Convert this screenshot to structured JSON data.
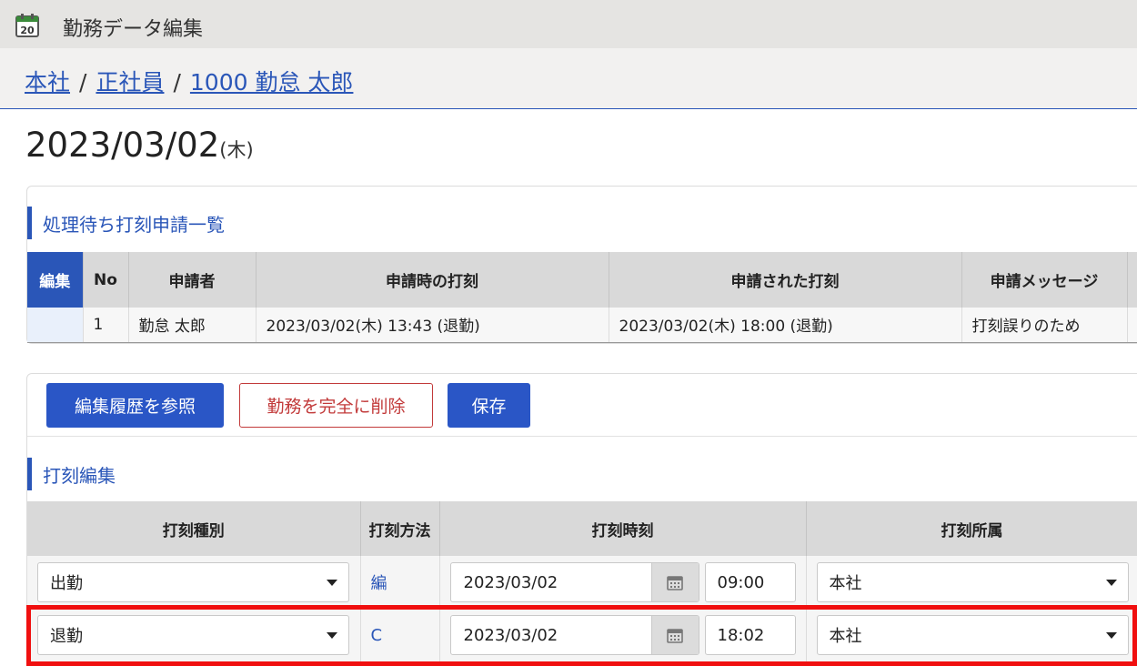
{
  "window": {
    "title": "勤務データ編集",
    "icon": "calendar-icon",
    "icon_number": "20"
  },
  "breadcrumb": {
    "items": [
      "本社",
      "正社員",
      "1000 勤怠 太郎"
    ],
    "separator": "/"
  },
  "page": {
    "date": "2023/03/02",
    "weekday": "(木)"
  },
  "pending_requests": {
    "title": "処理待ち打刻申請一覧",
    "headers": {
      "edit": "編集",
      "no": "No",
      "applicant": "申請者",
      "original": "申請時の打刻",
      "requested": "申請された打刻",
      "message": "申請メッセージ"
    },
    "rows": [
      {
        "no": "1",
        "applicant": "勤怠 太郎",
        "original": "2023/03/02(木) 13:43 (退勤)",
        "requested": "2023/03/02(木) 18:00 (退勤)",
        "message": "打刻誤りのため"
      }
    ]
  },
  "actions": {
    "history": "編集履歴を参照",
    "delete": "勤務を完全に削除",
    "save": "保存"
  },
  "punch_edit": {
    "title": "打刻編集",
    "headers": {
      "type": "打刻種別",
      "method": "打刻方法",
      "time": "打刻時刻",
      "affiliation": "打刻所属"
    },
    "rows": [
      {
        "type": "出勤",
        "method": "編",
        "date": "2023/03/02",
        "time": "09:00",
        "affiliation": "本社"
      },
      {
        "type": "退勤",
        "method": "C",
        "date": "2023/03/02",
        "time": "18:02",
        "affiliation": "本社"
      }
    ]
  },
  "colors": {
    "accent": "#2a56b8",
    "danger": "#c23a3a",
    "highlight": "#f00f0f"
  }
}
